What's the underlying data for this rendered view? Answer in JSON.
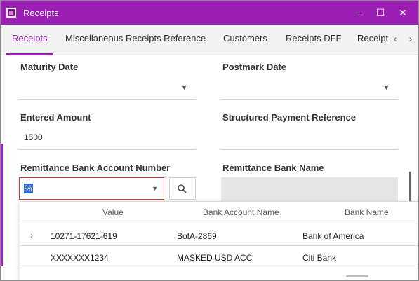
{
  "window": {
    "title": "Receipts",
    "controls": {
      "minimize": "−",
      "maximize": "☐",
      "close": "✕"
    }
  },
  "tabs": [
    {
      "label": "Receipts",
      "active": true
    },
    {
      "label": "Miscellaneous Receipts Reference"
    },
    {
      "label": "Customers"
    },
    {
      "label": "Receipts DFF"
    },
    {
      "label": "Receipt"
    }
  ],
  "tab_nav": {
    "prev": "‹",
    "next": "›"
  },
  "fields": {
    "maturity_date": {
      "label": "Maturity Date",
      "value": ""
    },
    "postmark_date": {
      "label": "Postmark Date",
      "value": ""
    },
    "entered_amount": {
      "label": "Entered Amount",
      "value": "1500"
    },
    "structured_payment_reference": {
      "label": "Structured Payment Reference",
      "value": ""
    },
    "remittance_bank_account_number": {
      "label": "Remittance Bank Account Number",
      "value": "%"
    },
    "remittance_bank_name": {
      "label": "Remittance Bank Name",
      "value": ""
    }
  },
  "lookup": {
    "columns": [
      "Value",
      "Bank Account Name",
      "Bank Name"
    ],
    "rows": [
      {
        "value": "10271-17621-619",
        "bank_account_name": "BofA-2869",
        "bank_name": "Bank of America",
        "expandable": true
      },
      {
        "value": "XXXXXXX1234",
        "bank_account_name": "MASKED USD ACC",
        "bank_name": "Citi Bank",
        "expandable": false
      }
    ]
  },
  "colors": {
    "accent": "#9b1fb5",
    "error_border": "#dd3333",
    "selection": "#2d6bd9"
  }
}
